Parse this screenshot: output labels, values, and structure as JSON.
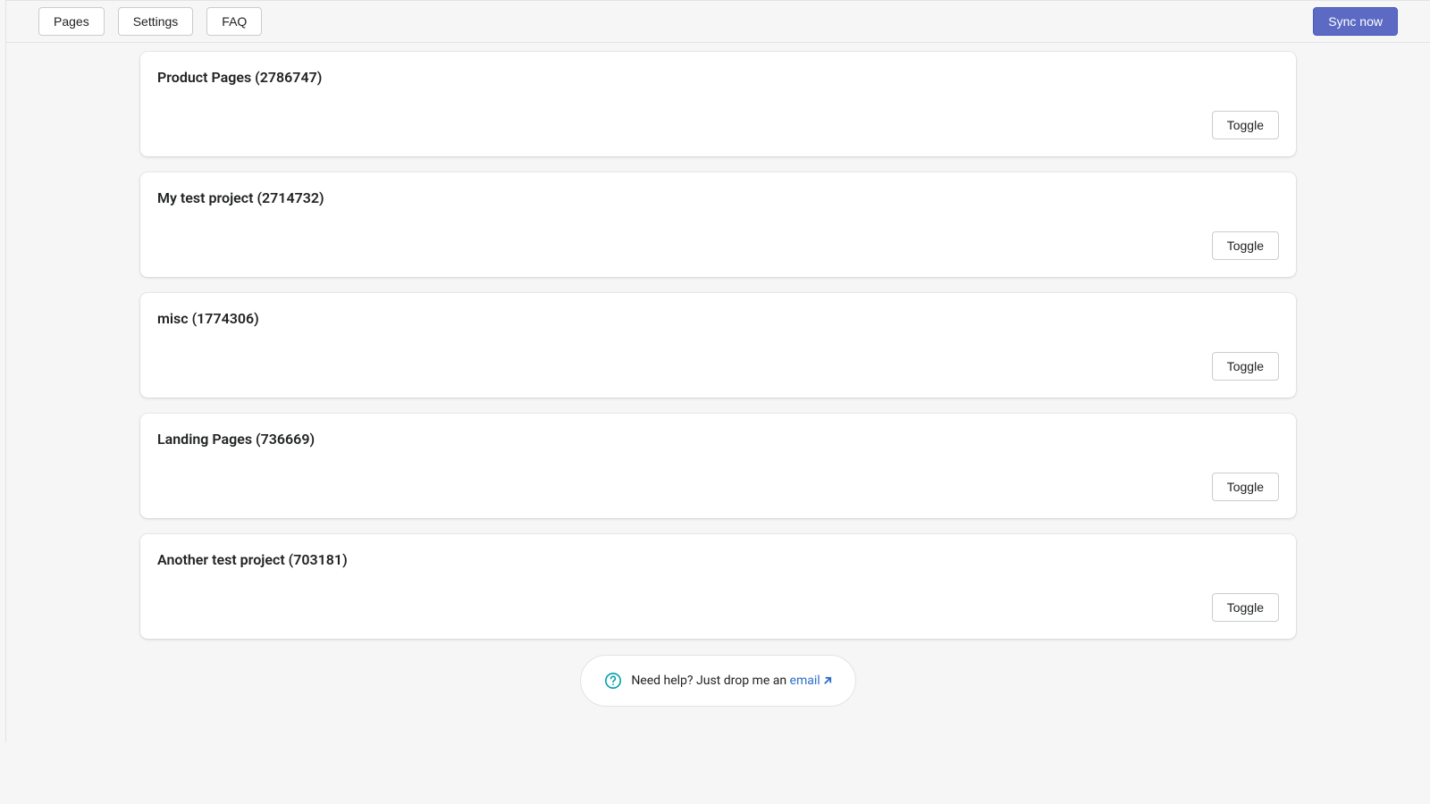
{
  "topbar": {
    "tabs": [
      {
        "label": "Pages"
      },
      {
        "label": "Settings"
      },
      {
        "label": "FAQ"
      }
    ],
    "sync_label": "Sync now"
  },
  "projects": [
    {
      "title": "Product Pages (2786747)",
      "toggle_label": "Toggle"
    },
    {
      "title": "My test project (2714732)",
      "toggle_label": "Toggle"
    },
    {
      "title": "misc (1774306)",
      "toggle_label": "Toggle"
    },
    {
      "title": "Landing Pages (736669)",
      "toggle_label": "Toggle"
    },
    {
      "title": "Another test project (703181)",
      "toggle_label": "Toggle"
    }
  ],
  "help": {
    "text": "Need help? Just drop me an ",
    "link_label": "email"
  }
}
